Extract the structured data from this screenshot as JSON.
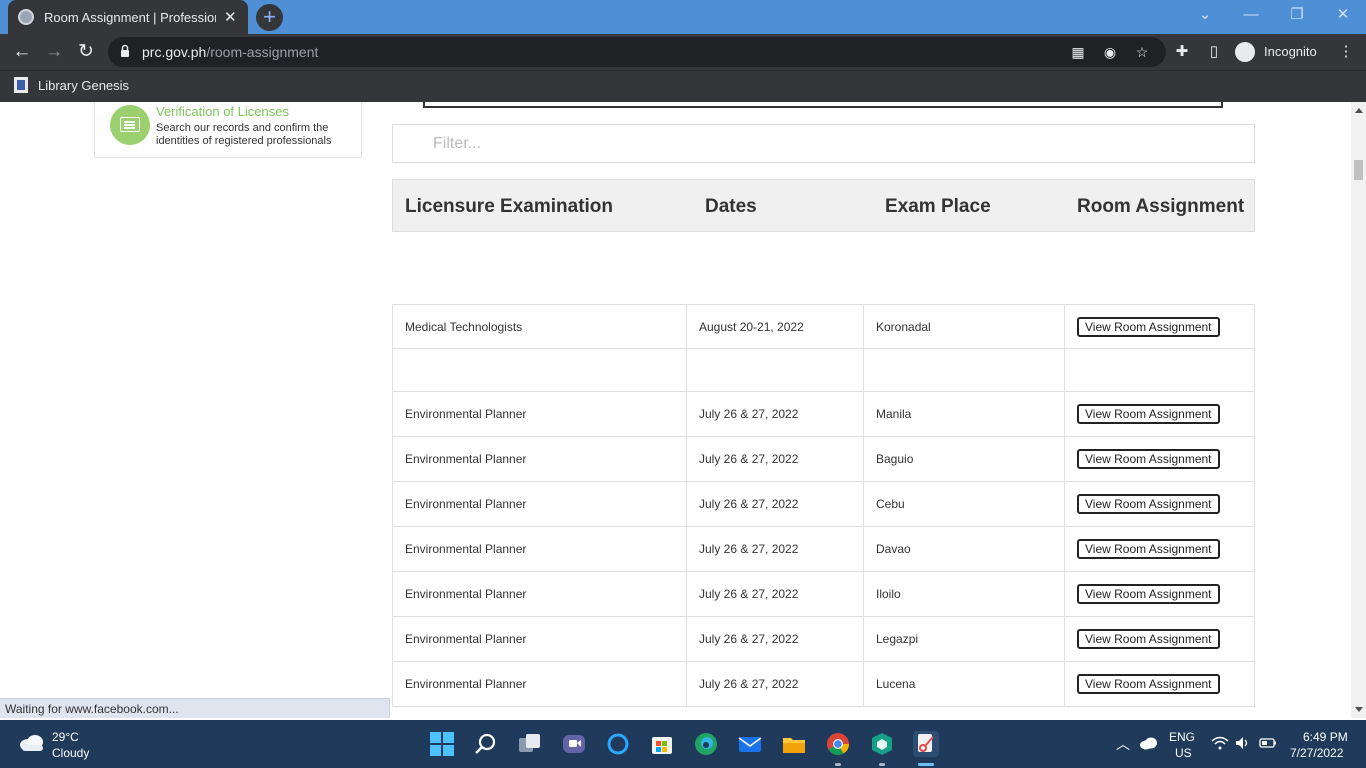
{
  "browser": {
    "tab_title": "Room Assignment | Professional Regulation Commission",
    "new_tab_symbol": "+",
    "url_host": "prc.gov.ph",
    "url_path": "/room-assignment",
    "bookmark": "Library Genesis",
    "profile_label": "Incognito",
    "status_text": "Waiting for www.facebook.com..."
  },
  "sidebar": {
    "title": "Verification of Licenses",
    "description": "Search our records and confirm the identities of registered professionals"
  },
  "filter": {
    "placeholder": "Filter..."
  },
  "table": {
    "headers": [
      "Licensure Examination",
      "Dates",
      "Exam Place",
      "Room Assignment"
    ],
    "button_label": "View Room Assignment",
    "rows": [
      {
        "exam": "Medical Technologists",
        "dates": "August 20-21, 2022",
        "place": "Koronadal"
      },
      {
        "exam": "",
        "dates": "",
        "place": "",
        "empty": true
      },
      {
        "exam": "Environmental Planner",
        "dates": "July 26 & 27, 2022",
        "place": "Manila"
      },
      {
        "exam": "Environmental Planner",
        "dates": "July 26 & 27, 2022",
        "place": "Baguio"
      },
      {
        "exam": "Environmental Planner",
        "dates": "July 26 & 27, 2022",
        "place": "Cebu"
      },
      {
        "exam": "Environmental Planner",
        "dates": "July 26 & 27, 2022",
        "place": "Davao"
      },
      {
        "exam": "Environmental Planner",
        "dates": "July 26 & 27, 2022",
        "place": "Iloilo"
      },
      {
        "exam": "Environmental Planner",
        "dates": "July 26 & 27, 2022",
        "place": "Legazpi"
      },
      {
        "exam": "Environmental Planner",
        "dates": "July 26 & 27, 2022",
        "place": "Lucena"
      }
    ]
  },
  "taskbar": {
    "temperature": "29°C",
    "condition": "Cloudy",
    "language": "ENG",
    "region": "US",
    "time": "6:49 PM",
    "date": "7/27/2022"
  },
  "colors": {
    "titlebar": "#4f8fd6",
    "chrome_dark": "#35363a",
    "accent_green": "#7cc35a",
    "taskbar": "#1f3a5a"
  }
}
